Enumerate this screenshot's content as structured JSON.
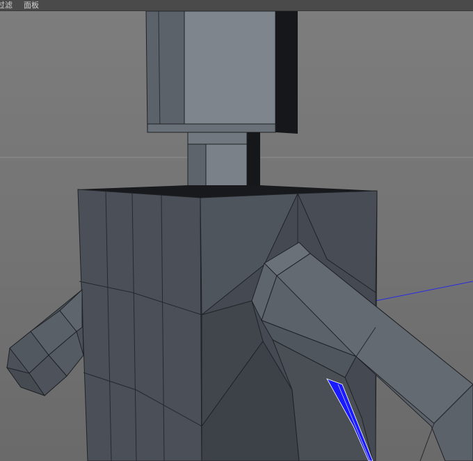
{
  "menu": {
    "items": [
      {
        "label": "过滤"
      },
      {
        "label": "面板"
      }
    ]
  },
  "viewport": {
    "background_top": "#7b7b7b",
    "background_bottom": "#6d6d6d",
    "horizon_color": "#8a8a8a",
    "mesh_fill": "#4a4f57",
    "mesh_light": "#5d636b",
    "mesh_lighter": "#6e747c",
    "mesh_dark": "#30343a",
    "edge_color": "#1f2226",
    "shadow_color": "#121416",
    "selected_polygon_color": "#1a1aff",
    "axis_line_color": "#2a2ae8"
  }
}
